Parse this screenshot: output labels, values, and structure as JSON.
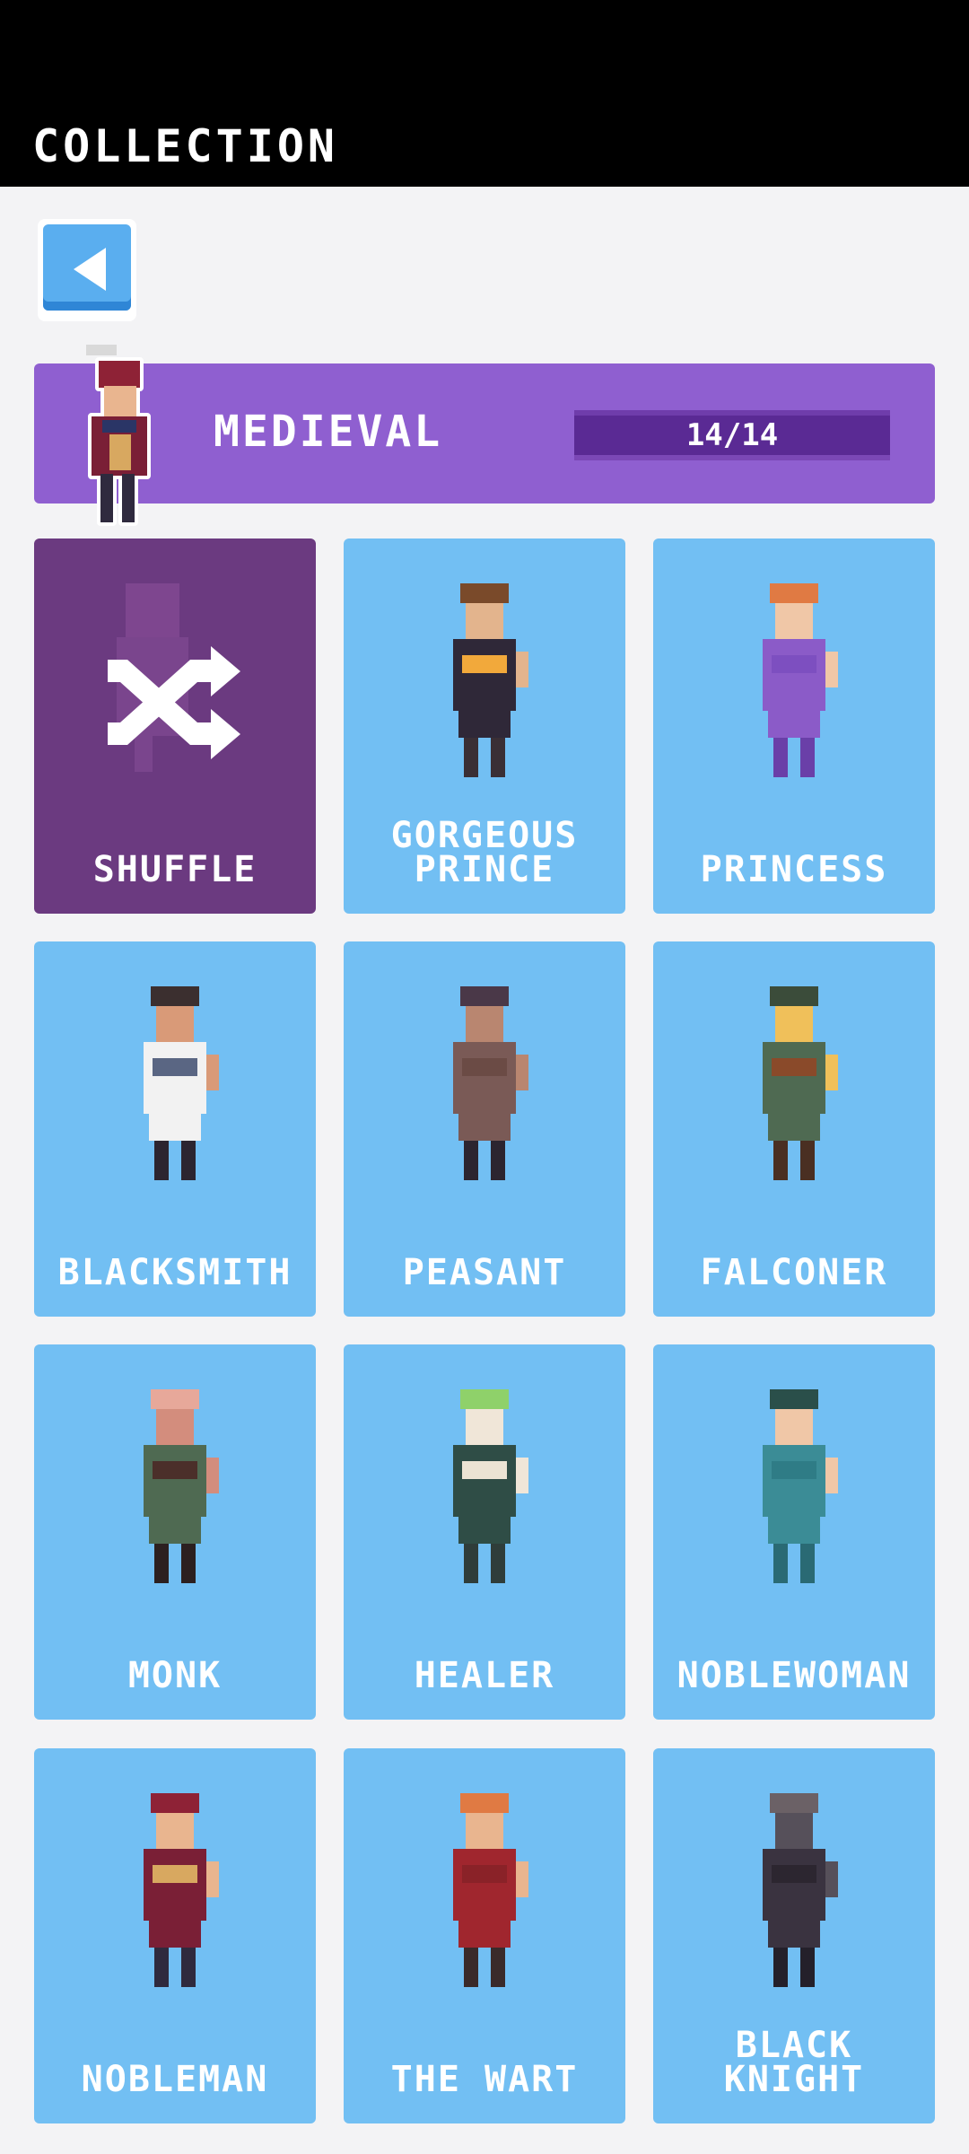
{
  "header": {
    "title": "COLLECTION"
  },
  "back_button": {
    "icon": "back-arrow-icon"
  },
  "category": {
    "name": "MEDIEVAL",
    "progress_text": "14/14",
    "progress": 1.0
  },
  "characters": [
    {
      "id": "shuffle",
      "label": "SHUFFLE",
      "icon": "shuffle-icon"
    },
    {
      "id": "gorgeous-prince",
      "label": "GORGEOUS\nPRINCE"
    },
    {
      "id": "princess",
      "label": "PRINCESS"
    },
    {
      "id": "blacksmith",
      "label": "BLACKSMITH"
    },
    {
      "id": "peasant",
      "label": "PEASANT"
    },
    {
      "id": "falconer",
      "label": "FALCONER"
    },
    {
      "id": "monk",
      "label": "MONK"
    },
    {
      "id": "healer",
      "label": "HEALER"
    },
    {
      "id": "noblewoman",
      "label": "NOBLEWOMAN"
    },
    {
      "id": "nobleman",
      "label": "NOBLEMAN"
    },
    {
      "id": "the-wart",
      "label": "THE WART"
    },
    {
      "id": "black-knight",
      "label": "BLACK\nKNIGHT"
    }
  ],
  "colors": {
    "card": "#72bff3",
    "shuffle_card": "#6b3a80",
    "banner": "#8f5fd0",
    "progress_fill": "#5a2a94"
  }
}
